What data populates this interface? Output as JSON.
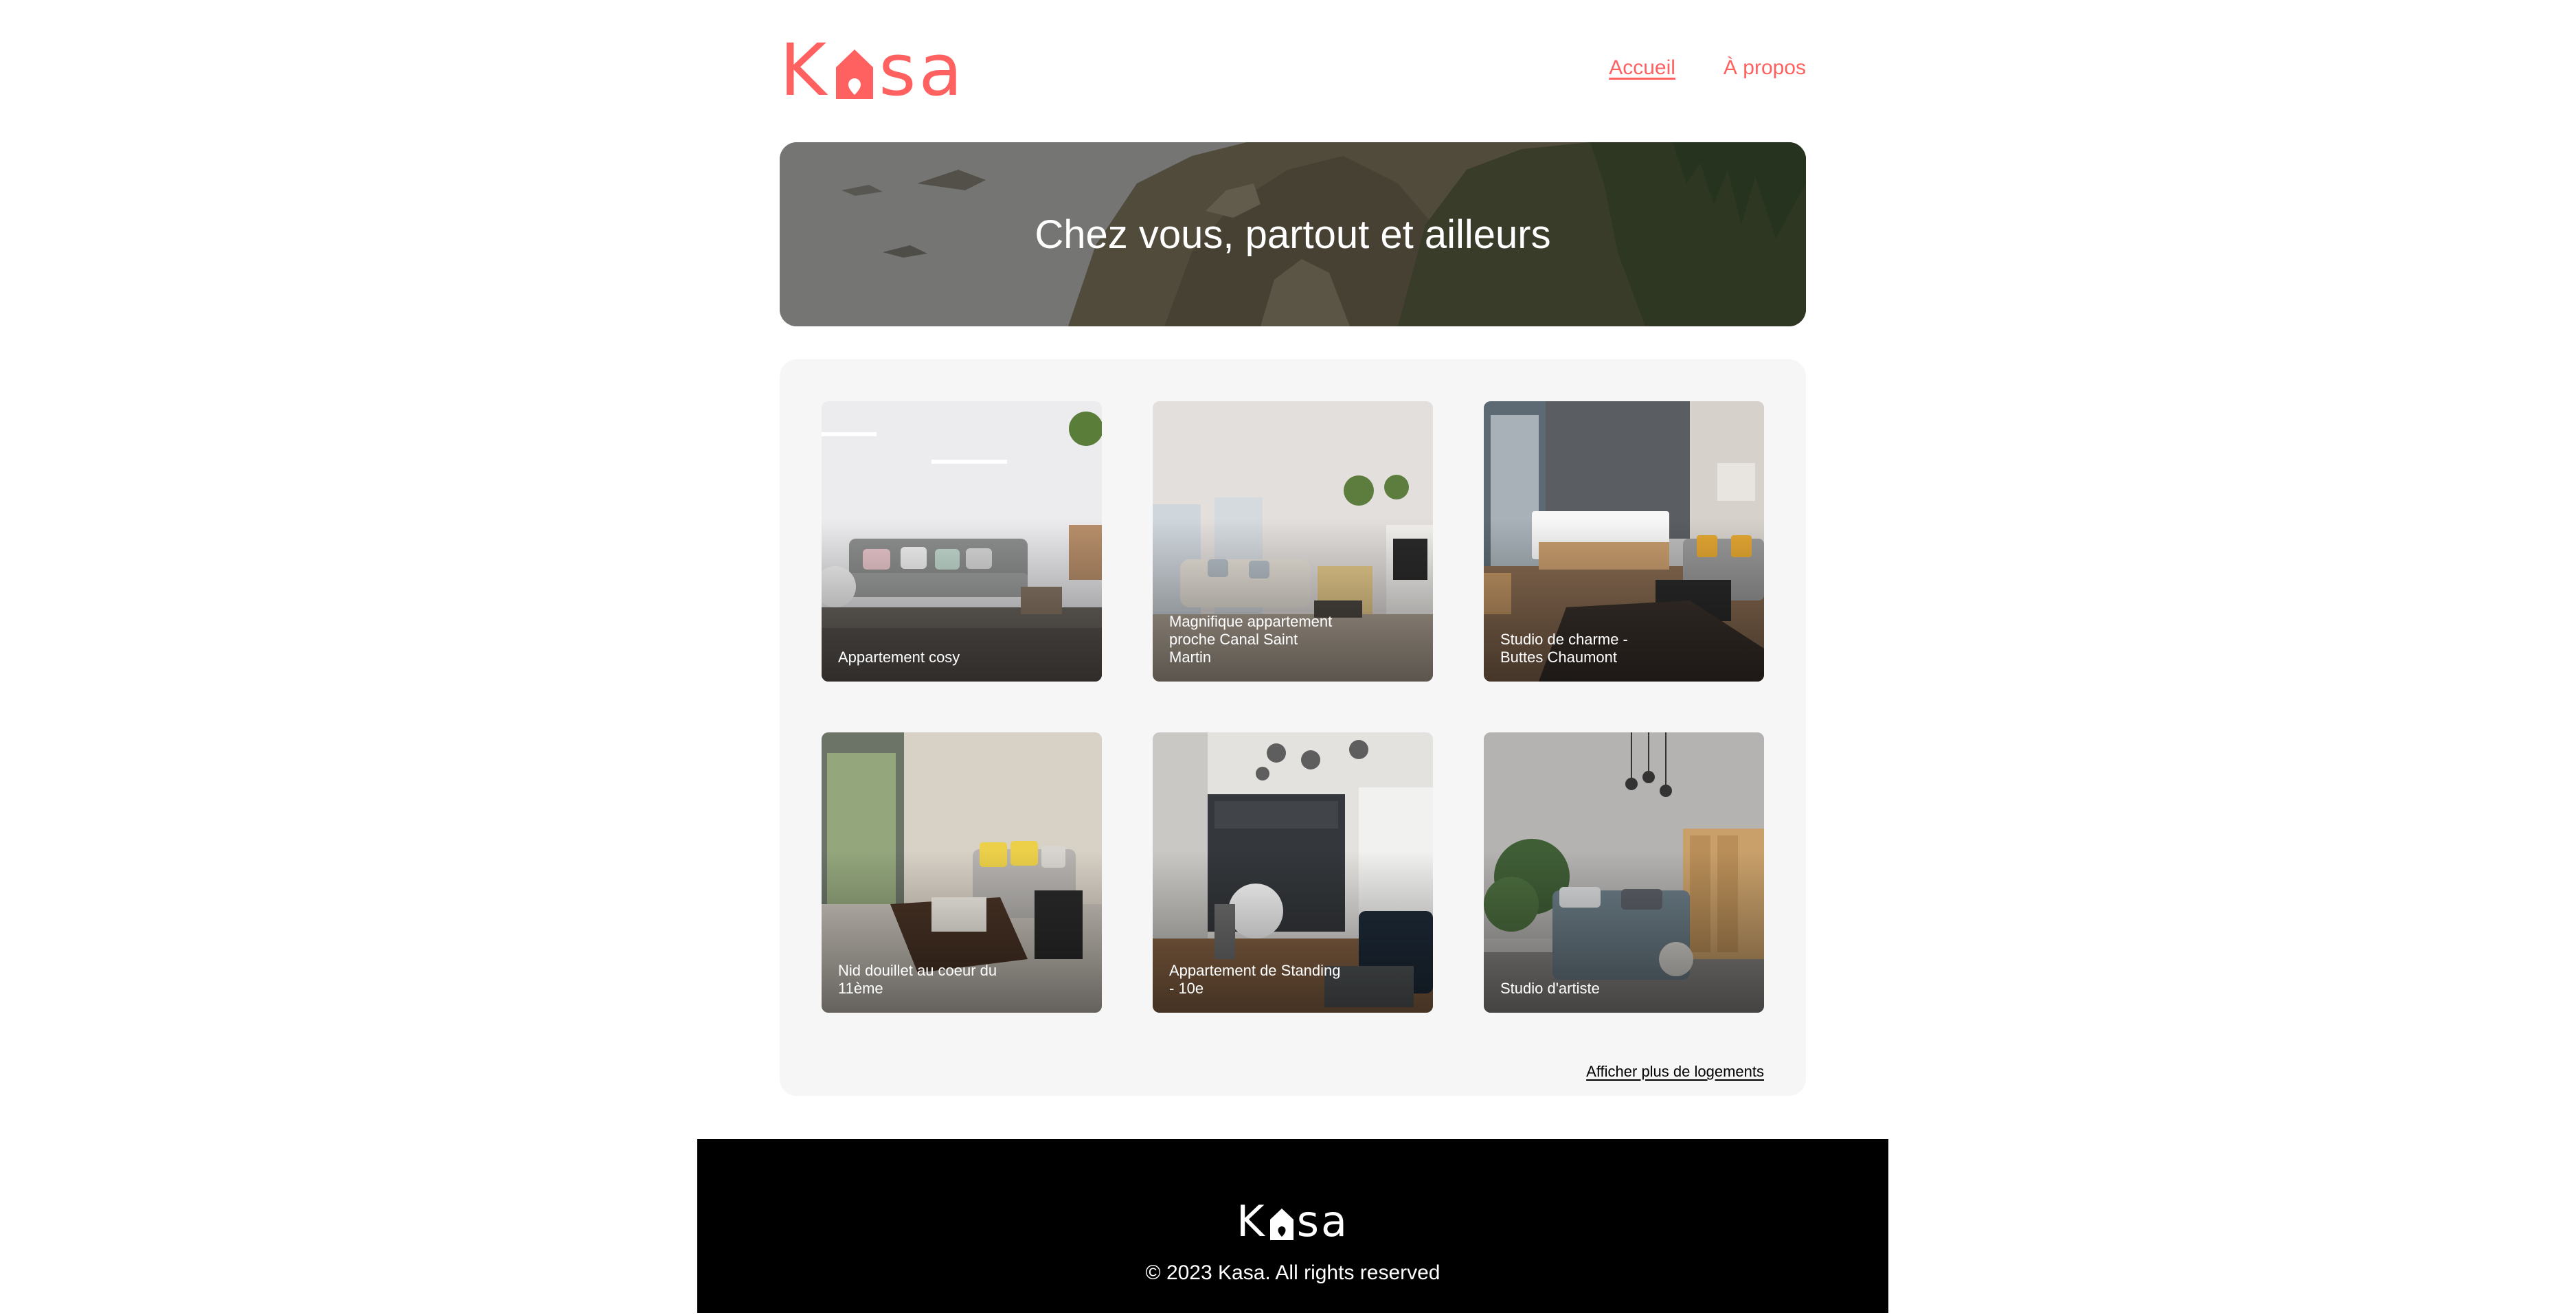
{
  "brand": {
    "name": "Kasa",
    "logo_left": "K",
    "logo_right": "sa",
    "color": "#FF6060"
  },
  "nav": {
    "items": [
      {
        "label": "Accueil",
        "active": true
      },
      {
        "label": "À propos",
        "active": false
      }
    ]
  },
  "banner": {
    "title": "Chez vous, partout et ailleurs"
  },
  "gallery": {
    "cards": [
      {
        "title": "Appartement cosy"
      },
      {
        "title": "Magnifique appartement proche Canal Saint Martin"
      },
      {
        "title": "Studio de charme - Buttes Chaumont"
      },
      {
        "title": "Nid douillet au coeur du 11ème"
      },
      {
        "title": "Appartement de Standing - 10e"
      },
      {
        "title": "Studio d'artiste"
      }
    ],
    "more_label": "Afficher plus de logements"
  },
  "footer": {
    "logo_left": "K",
    "logo_right": "sa",
    "copyright": "© 2023 Kasa. All rights reserved"
  }
}
